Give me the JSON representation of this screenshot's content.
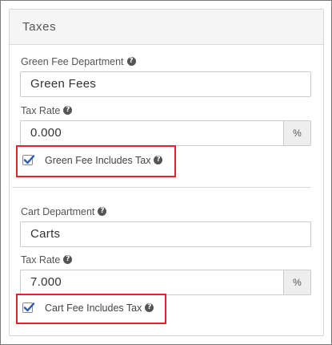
{
  "panel": {
    "title": "Taxes"
  },
  "green_fee": {
    "department_label": "Green Fee Department",
    "department_value": "Green Fees",
    "tax_rate_label": "Tax Rate",
    "tax_rate_value": "0.000",
    "tax_rate_unit": "%",
    "includes_tax_label": "Green Fee Includes Tax",
    "includes_tax_checked": true
  },
  "cart": {
    "department_label": "Cart Department",
    "department_value": "Carts",
    "tax_rate_label": "Tax Rate",
    "tax_rate_value": "7.000",
    "tax_rate_unit": "%",
    "includes_tax_label": "Cart Fee Includes Tax",
    "includes_tax_checked": true
  },
  "icons": {
    "help": "question-circle-icon",
    "check": "checkmark-icon"
  },
  "colors": {
    "highlight": "#e8202a",
    "checkmark": "#2a5db0",
    "header_bg": "#f5f5f5"
  }
}
